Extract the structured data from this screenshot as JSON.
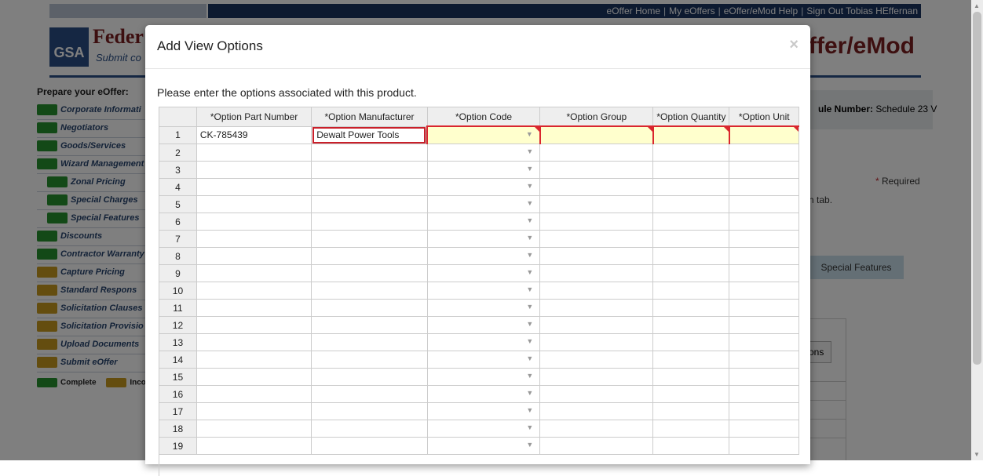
{
  "top_nav": {
    "links": [
      "eOffer Home",
      "My eOffers",
      "eOffer/eMod Help",
      "Sign Out Tobias HEffernan"
    ]
  },
  "header": {
    "logo": "GSA",
    "title": "Feder",
    "subtitle": "Submit co",
    "right_title": "ffer/eMod"
  },
  "sidebar": {
    "title": "Prepare your eOffer:",
    "items": [
      {
        "label": "Corporate Informati",
        "status": "complete",
        "indent": false
      },
      {
        "label": "Negotiators",
        "status": "complete",
        "indent": false
      },
      {
        "label": "Goods/Services",
        "status": "complete",
        "indent": false
      },
      {
        "label": "Wizard Management",
        "status": "complete",
        "indent": false
      },
      {
        "label": "Zonal Pricing",
        "status": "complete",
        "indent": true
      },
      {
        "label": "Special Charges",
        "status": "complete",
        "indent": true
      },
      {
        "label": "Special Features",
        "status": "complete",
        "indent": true
      },
      {
        "label": "Discounts",
        "status": "complete",
        "indent": false
      },
      {
        "label": "Contractor Warranty",
        "status": "complete",
        "indent": false
      },
      {
        "label": "Capture Pricing",
        "status": "incomplete",
        "indent": false
      },
      {
        "label": "Standard Respons",
        "status": "incomplete",
        "indent": false
      },
      {
        "label": "Solicitation Clauses",
        "status": "incomplete",
        "indent": false
      },
      {
        "label": "Solicitation Provisio",
        "status": "incomplete",
        "indent": false
      },
      {
        "label": "Upload Documents",
        "status": "incomplete",
        "indent": false
      },
      {
        "label": "Submit eOffer",
        "status": "incomplete",
        "indent": false
      }
    ],
    "legend": {
      "complete": "Complete",
      "incomplete": "Inco"
    }
  },
  "background_content": {
    "schedule_label": "ule Number:",
    "schedule_value": "Schedule 23 V",
    "required_star": "*",
    "required_text": " Required",
    "tab_note": "h tab.",
    "special_features_tab": "Special Features",
    "options_button": "ons"
  },
  "modal": {
    "title": "Add View Options",
    "close_glyph": "×",
    "instructions": "Please enter the options associated with this product.",
    "columns": [
      "*Option Part Number",
      "*Option Manufacturer",
      "*Option Code",
      "*Option Group",
      "*Option Quantity",
      "*Option Unit"
    ],
    "rows": [
      {
        "num": "1",
        "part_number": "CK-785439",
        "manufacturer": "Dewalt Power Tools"
      },
      {
        "num": "2",
        "part_number": "",
        "manufacturer": ""
      },
      {
        "num": "3",
        "part_number": "",
        "manufacturer": ""
      },
      {
        "num": "4",
        "part_number": "",
        "manufacturer": ""
      },
      {
        "num": "5",
        "part_number": "",
        "manufacturer": ""
      },
      {
        "num": "6",
        "part_number": "",
        "manufacturer": ""
      },
      {
        "num": "7",
        "part_number": "",
        "manufacturer": ""
      },
      {
        "num": "8",
        "part_number": "",
        "manufacturer": ""
      },
      {
        "num": "9",
        "part_number": "",
        "manufacturer": ""
      },
      {
        "num": "10",
        "part_number": "",
        "manufacturer": ""
      },
      {
        "num": "11",
        "part_number": "",
        "manufacturer": ""
      },
      {
        "num": "12",
        "part_number": "",
        "manufacturer": ""
      },
      {
        "num": "13",
        "part_number": "",
        "manufacturer": ""
      },
      {
        "num": "14",
        "part_number": "",
        "manufacturer": ""
      },
      {
        "num": "15",
        "part_number": "",
        "manufacturer": ""
      },
      {
        "num": "16",
        "part_number": "",
        "manufacturer": ""
      },
      {
        "num": "17",
        "part_number": "",
        "manufacturer": ""
      },
      {
        "num": "18",
        "part_number": "",
        "manufacturer": ""
      },
      {
        "num": "19",
        "part_number": "",
        "manufacturer": ""
      }
    ],
    "dropdown_glyph": "▼"
  },
  "colors": {
    "brand_navy": "#1a3461",
    "brand_maroon": "#7a1f21",
    "complete_green": "#26932f",
    "incomplete_gold": "#c99a1f",
    "invalid_fill": "#ffffcd",
    "invalid_border": "#d9262e"
  },
  "icons": {
    "complete": "check-icon",
    "incomplete": "exclamation-icon",
    "dropdown": "dropdown-arrow-icon",
    "close": "close-icon"
  }
}
